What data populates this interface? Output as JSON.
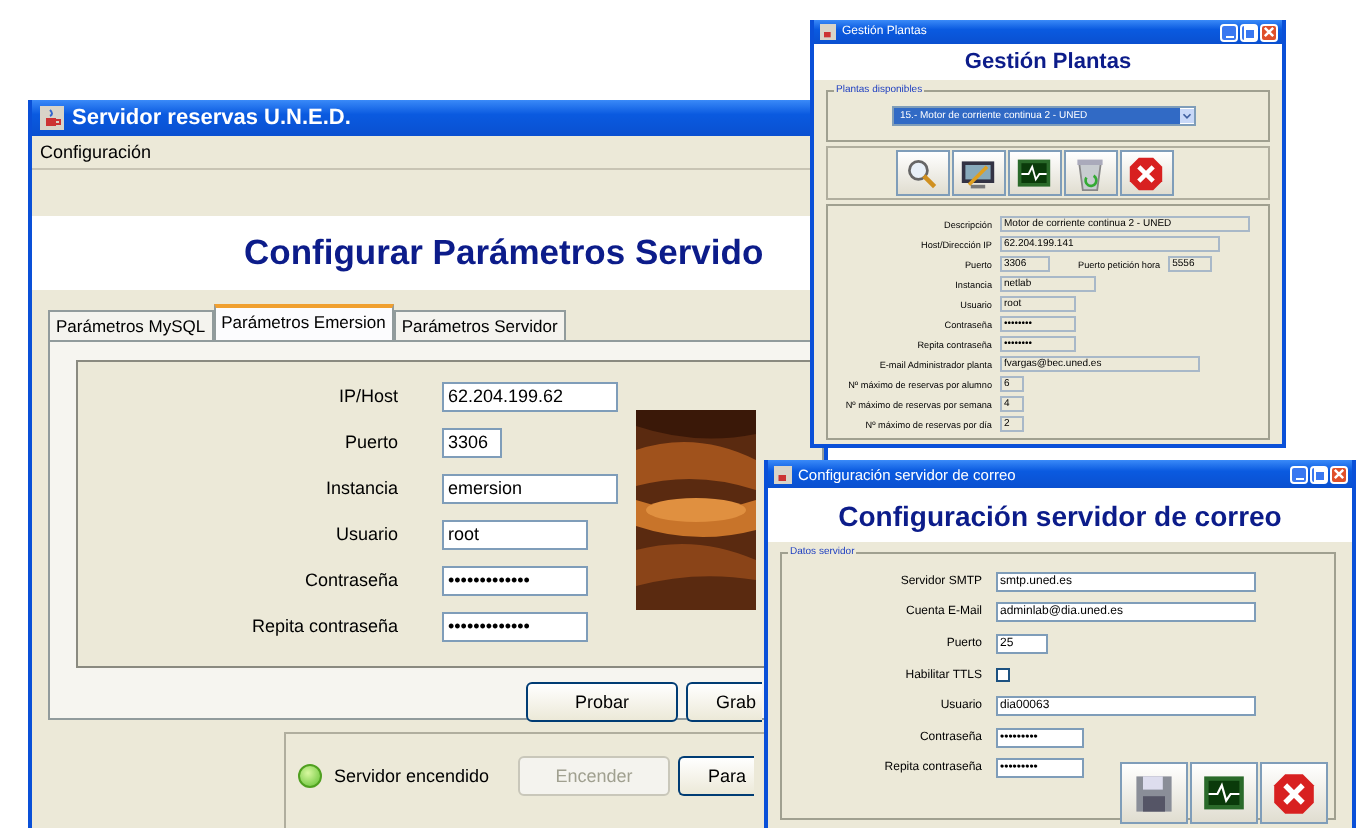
{
  "main_window": {
    "title": "Servidor reservas U.N.E.D.",
    "menu": [
      "Configuración"
    ],
    "heading": "Configurar Parámetros Servido",
    "tabs": [
      {
        "label": "Parámetros MySQL",
        "selected": false
      },
      {
        "label": "Parámetros Emersion",
        "selected": true
      },
      {
        "label": "Parámetros Servidor",
        "selected": false
      }
    ],
    "fields": [
      {
        "label": "IP/Host",
        "value": "62.204.199.62"
      },
      {
        "label": "Puerto",
        "value": "3306"
      },
      {
        "label": "Instancia",
        "value": "emersion"
      },
      {
        "label": "Usuario",
        "value": "root"
      },
      {
        "label": "Contraseña",
        "value": "•••••••••••••"
      },
      {
        "label": "Repita contraseña",
        "value": "•••••••••••••"
      }
    ],
    "buttons": [
      {
        "label": "Probar",
        "disabled": false
      },
      {
        "label": "Grab",
        "disabled": false
      }
    ],
    "status": {
      "text": "Servidor encendido",
      "on": true
    },
    "status_buttons": [
      {
        "label": "Encender",
        "disabled": true
      },
      {
        "label": "Para",
        "disabled": false
      }
    ]
  },
  "plants_window": {
    "title": "Gestión Plantas",
    "heading": "Gestión Plantas",
    "group_label": "Plantas disponibles",
    "selected_plant": "15.- Motor de corriente continua 2 - UNED",
    "toolbar": [
      {
        "kind": "search"
      },
      {
        "kind": "tools"
      },
      {
        "kind": "monitor"
      },
      {
        "kind": "bin"
      },
      {
        "kind": "close"
      }
    ],
    "details": [
      {
        "label": "Descripción",
        "value": "Motor de corriente continua 2 - UNED"
      },
      {
        "label": "Host/Dirección IP",
        "value": "62.204.199.141"
      },
      {
        "label": "Puerto",
        "value": "3306",
        "extra_label": "Puerto petición hora",
        "extra_value": "5556"
      },
      {
        "label": "Instancia",
        "value": "netlab"
      },
      {
        "label": "Usuario",
        "value": "root"
      },
      {
        "label": "Contraseña",
        "value": "••••••••"
      },
      {
        "label": "Repita contraseña",
        "value": "••••••••"
      },
      {
        "label": "E-mail Administrador planta",
        "value": "fvargas@bec.uned.es"
      },
      {
        "label": "Nº máximo de reservas por alumno",
        "value": "6"
      },
      {
        "label": "Nº máximo de reservas por semana",
        "value": "4"
      },
      {
        "label": "Nº máximo de reservas por día",
        "value": "2"
      }
    ]
  },
  "mail_window": {
    "title": "Configuración servidor de correo",
    "heading": "Configuración servidor de correo",
    "group_label": "Datos servidor",
    "fields": [
      {
        "kind": "text",
        "label": "Servidor SMTP",
        "value": "smtp.uned.es"
      },
      {
        "kind": "text",
        "label": "Cuenta E-Mail",
        "value": "adminlab@dia.uned.es"
      },
      {
        "kind": "text",
        "label": "Puerto",
        "value": "25"
      },
      {
        "kind": "checkbox",
        "label": "Habilitar TTLS",
        "checked": false
      },
      {
        "kind": "text",
        "label": "Usuario",
        "value": "dia00063"
      },
      {
        "kind": "text",
        "label": "Contraseña",
        "value": "•••••••••"
      },
      {
        "kind": "text",
        "label": "Repita contraseña",
        "value": "•••••••••"
      }
    ],
    "buttons": [
      {
        "kind": "save"
      },
      {
        "kind": "monitor"
      },
      {
        "kind": "close"
      }
    ]
  }
}
